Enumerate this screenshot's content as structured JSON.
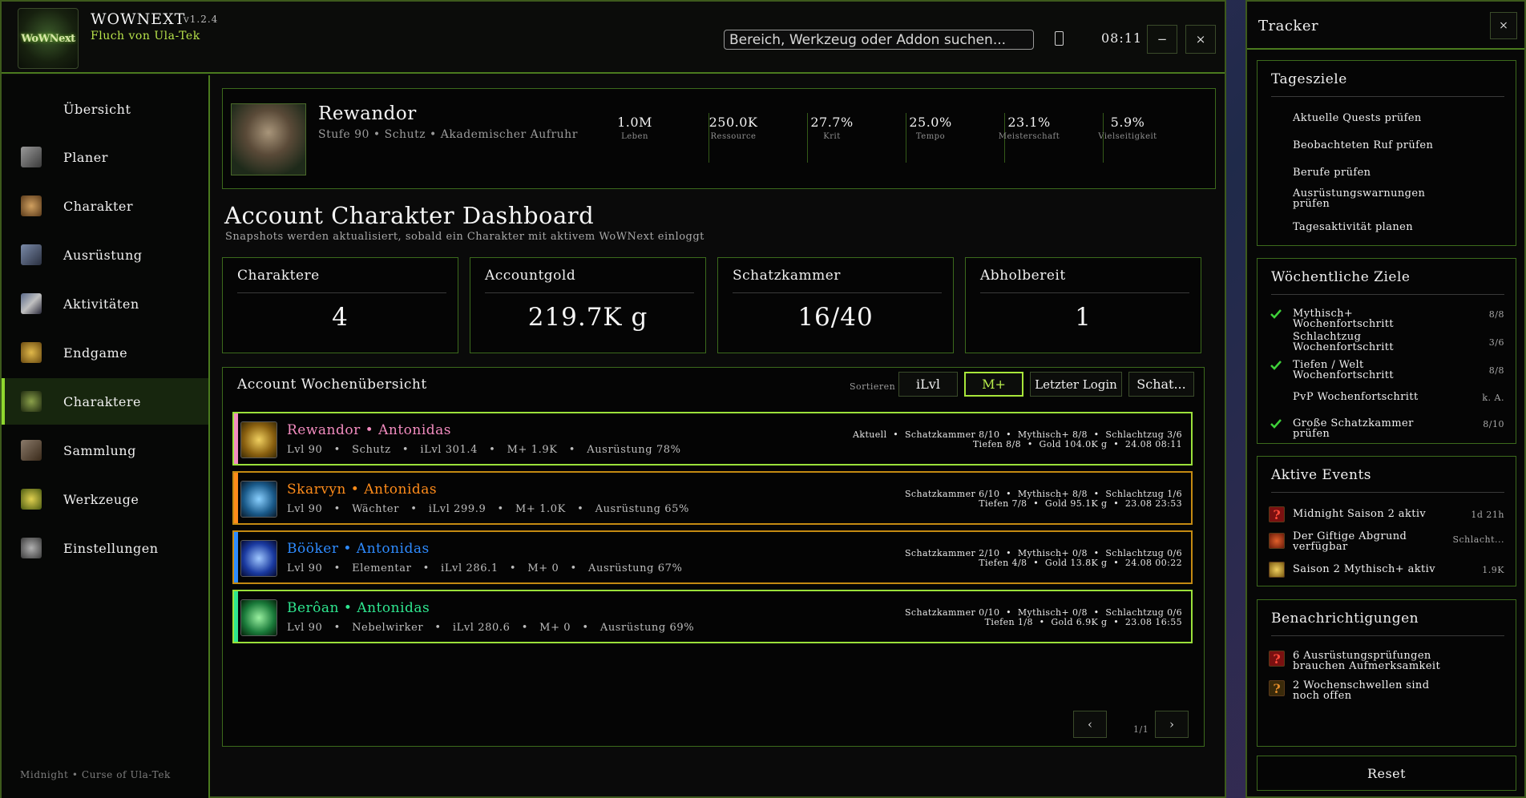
{
  "app": {
    "title": "WOWNEXT",
    "version": "v1.2.4",
    "subtitle": "Fluch von Ula-Tek",
    "logo_text": "WoWNext",
    "search_placeholder": "Bereich, Werkzeug oder Addon suchen...",
    "clock": "08:11",
    "minimize_label": "−",
    "close_label": "×"
  },
  "sidebar": {
    "items": [
      {
        "label": "Übersicht",
        "icon": "overview-icon"
      },
      {
        "label": "Planer",
        "icon": "planner-icon"
      },
      {
        "label": "Charakter",
        "icon": "character-icon"
      },
      {
        "label": "Ausrüstung",
        "icon": "equipment-icon"
      },
      {
        "label": "Aktivitäten",
        "icon": "activities-icon"
      },
      {
        "label": "Endgame",
        "icon": "endgame-icon"
      },
      {
        "label": "Charaktere",
        "icon": "characters-icon",
        "active": true
      },
      {
        "label": "Sammlung",
        "icon": "collection-icon"
      },
      {
        "label": "Werkzeuge",
        "icon": "tools-icon"
      },
      {
        "label": "Einstellungen",
        "icon": "settings-icon"
      }
    ],
    "footer": "Midnight • Curse of Ula-Tek"
  },
  "profile": {
    "name": "Rewandor",
    "subtitle": "Stufe 90 • Schutz • Akademischer Aufruhr",
    "stats": [
      {
        "value": "1.0M",
        "label": "Leben"
      },
      {
        "value": "250.0K",
        "label": "Ressource"
      },
      {
        "value": "27.7%",
        "label": "Krit"
      },
      {
        "value": "25.0%",
        "label": "Tempo"
      },
      {
        "value": "23.1%",
        "label": "Meisterschaft"
      },
      {
        "value": "5.9%",
        "label": "Vielseitigkeit"
      }
    ]
  },
  "dashboard": {
    "title": "Account Charakter Dashboard",
    "subtitle": "Snapshots werden aktualisiert, sobald ein Charakter mit aktivem WoWNext einloggt",
    "kpis": [
      {
        "label": "Charaktere",
        "value": "4"
      },
      {
        "label": "Accountgold",
        "value": "219.7K g"
      },
      {
        "label": "Schatzkammer",
        "value": "16/40"
      },
      {
        "label": "Abholbereit",
        "value": "1"
      }
    ]
  },
  "weekly": {
    "title": "Account Wochenübersicht",
    "sort_label": "Sortieren",
    "sort_buttons": [
      {
        "label": "iLvl"
      },
      {
        "label": "M+",
        "active": true
      },
      {
        "label": "Letzter Login"
      },
      {
        "label": "Schat..."
      }
    ],
    "characters": [
      {
        "name": "Rewandor",
        "realm": "Antonidas",
        "name_color": "#f28cbf",
        "realm_color": "#f28cbf",
        "stripe_color": "#f28cbf",
        "icon": "paladin-icon",
        "detail": "Lvl 90   •   Schutz   •   iLvl 301.4   •   M+ 1.9K   •   Ausrüstung 78%",
        "right1": "Aktuell  •  Schatzkammer 8/10  •  Mythisch+ 8/8  •  Schlachtzug 3/6",
        "right2": "Tiefen 8/8  •  Gold 104.0K g  •  24.08 08:11",
        "selected": true
      },
      {
        "name": "Skarvyn",
        "realm": "Antonidas",
        "name_color": "#ff8c1a",
        "realm_color": "#ff8c1a",
        "stripe_color": "#ff8c1a",
        "icon": "druid-guardian-icon",
        "detail": "Lvl 90   •   Wächter   •   iLvl 299.9   •   M+ 1.0K   •   Ausrüstung 65%",
        "right1": "Schatzkammer 6/10  •  Mythisch+ 8/8  •  Schlachtzug 1/6",
        "right2": "Tiefen 7/8  •  Gold 95.1K g  •  23.08 23:53",
        "selected": false
      },
      {
        "name": "Bööker",
        "realm": "Antonidas",
        "name_color": "#2e8bff",
        "realm_color": "#2e8bff",
        "stripe_color": "#2e8bff",
        "icon": "shaman-elemental-icon",
        "detail": "Lvl 90   •   Elementar   •   iLvl 286.1   •   M+ 0   •   Ausrüstung 67%",
        "right1": "Schatzkammer 2/10  •  Mythisch+ 0/8  •  Schlachtzug 0/6",
        "right2": "Tiefen 4/8  •  Gold 13.8K g  •  24.08 00:22",
        "selected": false
      },
      {
        "name": "Berôan",
        "realm": "Antonidas",
        "name_color": "#2ee68f",
        "realm_color": "#2ee68f",
        "stripe_color": "#2ee68f",
        "icon": "monk-mistweaver-icon",
        "detail": "Lvl 90   •   Nebelwirker   •   iLvl 280.6   •   M+ 0   •   Ausrüstung 69%",
        "right1": "Schatzkammer 0/10  •  Mythisch+ 0/8  •  Schlachtzug 0/6",
        "right2": "Tiefen 1/8  •  Gold 6.9K g  •  23.08 16:55",
        "selected": true
      }
    ],
    "pager": {
      "prev": "‹",
      "info": "1/1",
      "next": "›"
    }
  },
  "tracker": {
    "title": "Tracker",
    "close_label": "×",
    "daily": {
      "title": "Tagesziele",
      "items": [
        "Aktuelle Quests prüfen",
        "Beobachteten Ruf prüfen",
        "Berufe prüfen",
        "Ausrüstungswarnungen prüfen",
        "Tagesaktivität planen"
      ]
    },
    "weekly": {
      "title": "Wöchentliche Ziele",
      "items": [
        {
          "label": "Mythisch+ Wochenfortschritt",
          "value": "8/8",
          "done": true
        },
        {
          "label": "Schlachtzug Wochenfortschritt",
          "value": "3/6",
          "done": false
        },
        {
          "label": "Tiefen / Welt Wochenfortschritt",
          "value": "8/8",
          "done": true
        },
        {
          "label": "PvP Wochenfortschritt",
          "value": "k. A.",
          "done": false
        },
        {
          "label": "Große Schatzkammer prüfen",
          "value": "8/10",
          "done": true
        }
      ]
    },
    "events": {
      "title": "Aktive Events",
      "items": [
        {
          "label": "Midnight Saison 2 aktiv",
          "value": "1d 21h",
          "icon": "question-icon"
        },
        {
          "label": "Der Giftige Abgrund verfügbar",
          "value": "Schlacht...",
          "icon": "abyss-icon"
        },
        {
          "label": "Saison 2 Mythisch+ aktiv",
          "value": "1.9K",
          "icon": "keystone-icon"
        }
      ]
    },
    "notifications": {
      "title": "Benachrichtigungen",
      "items": [
        "6 Ausrüstungsprüfungen brauchen Aufmerksamkeit",
        "2 Wochenschwellen sind noch offen"
      ]
    },
    "reset_label": "Reset"
  },
  "colors": {
    "accent_green": "#8fd72e",
    "border_green": "#3c6a1c",
    "active_row_border": "#9be03a",
    "row_border_orange": "#c48a12"
  }
}
